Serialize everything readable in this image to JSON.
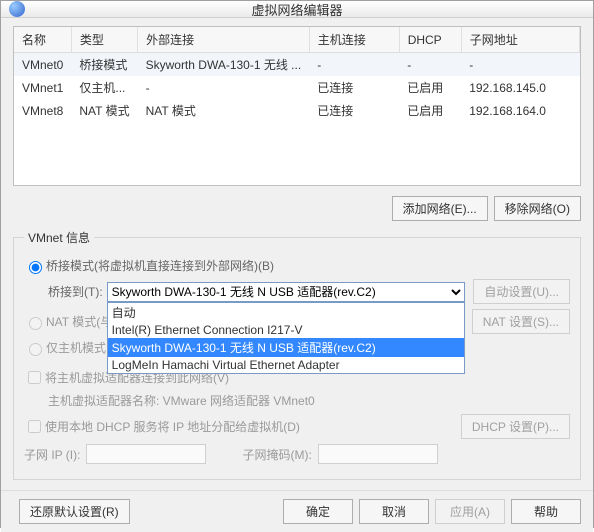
{
  "title": "虚拟网络编辑器",
  "cols": {
    "name": "名称",
    "type": "类型",
    "ext": "外部连接",
    "host": "主机连接",
    "dhcp": "DHCP",
    "subnet": "子网地址"
  },
  "rows": [
    {
      "name": "VMnet0",
      "type": "桥接模式",
      "ext": "Skyworth DWA-130-1 无线 ...",
      "host": "-",
      "dhcp": "-",
      "subnet": "-"
    },
    {
      "name": "VMnet1",
      "type": "仅主机...",
      "ext": "-",
      "host": "已连接",
      "dhcp": "已启用",
      "subnet": "192.168.145.0"
    },
    {
      "name": "VMnet8",
      "type": "NAT 模式",
      "ext": "NAT 模式",
      "host": "已连接",
      "dhcp": "已启用",
      "subnet": "192.168.164.0"
    }
  ],
  "btns": {
    "add": "添加网络(E)...",
    "remove": "移除网络(O)"
  },
  "info": {
    "legend": "VMnet 信息",
    "bridged": "桥接模式(将虚拟机直接连接到外部网络)(B)",
    "bridgeTo": "桥接到(T):",
    "comboValue": "Skyworth DWA-130-1 无线 N USB 适配器(rev.C2)",
    "options": [
      "自动",
      "Intel(R) Ethernet Connection I217-V",
      "Skyworth DWA-130-1 无线 N USB 适配器(rev.C2)",
      "LogMeIn Hamachi Virtual Ethernet Adapter"
    ],
    "autoset": "自动设置(U)...",
    "nat": "NAT 模式(与",
    "natset": "NAT 设置(S)...",
    "hostonly": "仅主机模式",
    "connectHost": "将主机虚拟适配器连接到此网络(V)",
    "adapterName": "主机虚拟适配器名称: VMware 网络适配器 VMnet0",
    "usedhcp": "使用本地 DHCP 服务将 IP 地址分配给虚拟机(D)",
    "dhcpset": "DHCP 设置(P)...",
    "subnetIp": "子网 IP (I):",
    "subnetMask": "子网掩码(M):"
  },
  "footer": {
    "restore": "还原默认设置(R)",
    "ok": "确定",
    "cancel": "取消",
    "apply": "应用(A)",
    "help": "帮助"
  }
}
